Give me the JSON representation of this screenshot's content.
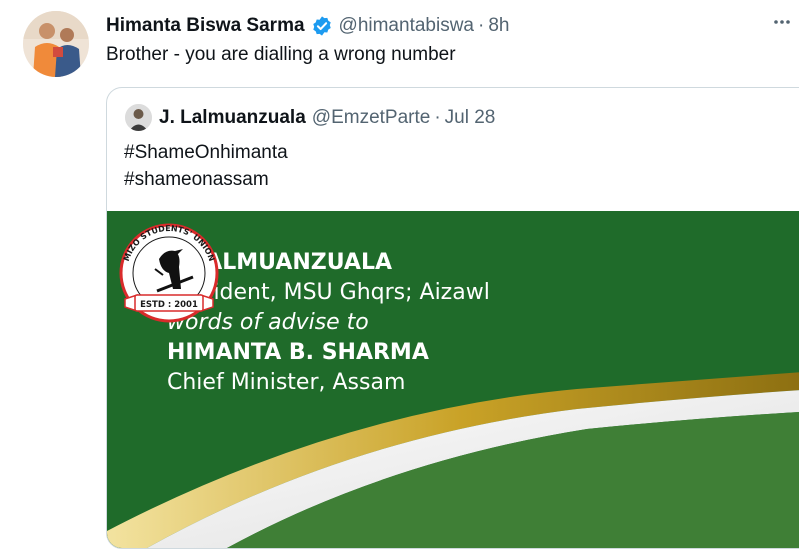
{
  "tweet": {
    "author_name": "Himanta Biswa Sarma",
    "handle": "@himantabiswa",
    "separator": "·",
    "time": "8h",
    "text": "Brother - you are dialling a wrong number"
  },
  "quoted_tweet": {
    "author_name": "J. Lalmuanzuala",
    "handle": "@EmzetParte",
    "separator": "·",
    "date": "Jul 28",
    "lines": [
      "#ShameOnhimanta",
      "#shameonassam"
    ],
    "image": {
      "line1": "J. LALMUANZUALA",
      "line2": "President, MSU Ghqrs; Aizawl",
      "line3": "words of advise to",
      "line4": "HIMANTA B. SHARMA",
      "line5": "Chief Minister, Assam",
      "logo_top_text": "MIZO STUDENTS' UNION",
      "logo_bottom_text": "ESTD : 2001"
    }
  },
  "icons": {
    "verified": "verified-badge-icon",
    "more": "more-options-icon"
  },
  "colors": {
    "green": "#1f6b2a",
    "verified_blue": "#1d9bf0",
    "secondary_text": "#536471",
    "gold": "#c9a227",
    "logo_red": "#d92b2b"
  }
}
